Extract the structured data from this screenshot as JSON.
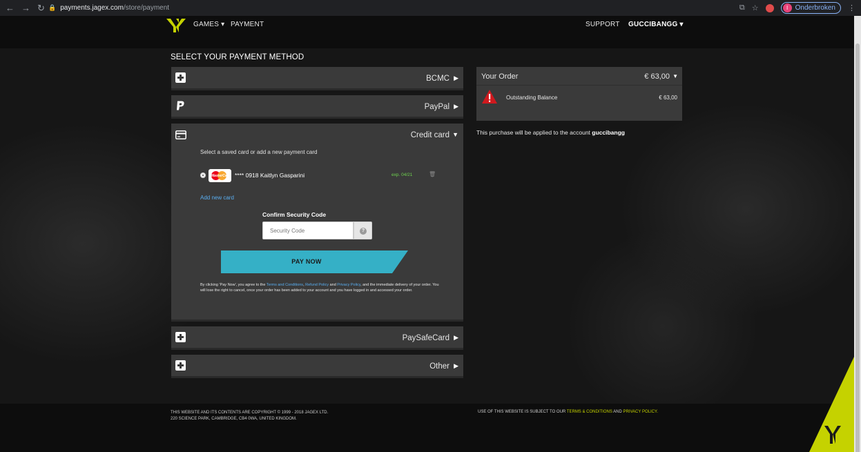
{
  "browser": {
    "url_host": "payments.jagex.com",
    "url_path": "/store/payment",
    "profile_initial": "I",
    "profile_label": "Onderbroken"
  },
  "nav": {
    "games": "GAMES ▾",
    "payment": "PAYMENT",
    "support": "SUPPORT",
    "user": "GUCCIBANGG ▾"
  },
  "page": {
    "section_title": "SELECT YOUR PAYMENT METHOD"
  },
  "methods": {
    "bcmc": "BCMC",
    "paypal": "PayPal",
    "credit_card": "Credit card",
    "paysafecard": "PaySafeCard",
    "other": "Other"
  },
  "credit_card": {
    "subtitle": "Select a saved card or add a new payment card",
    "card_brand_text": "MasterCard",
    "card_number": "**** 0918  Kaitlyn Gasparini",
    "card_expiry": "exp. 04/21",
    "add_new_card": "Add new card",
    "confirm_label": "Confirm Security Code",
    "security_placeholder": "Security Code",
    "help_glyph": "?",
    "pay_now": "PAY NOW",
    "terms_1": "By clicking 'Pay Now', you agree to the ",
    "terms_link_1": "Terms and Conditions",
    "terms_2": ", ",
    "terms_link_2": "Refund Policy",
    "terms_3": " and ",
    "terms_link_3": "Privacy Policy",
    "terms_4": ", and the immediate delivery of your order. You will lose the right to cancel, once your order has been added to your account and you have logged in and accessed your order."
  },
  "order": {
    "title": "Your Order",
    "total": "€ 63,00",
    "balance_label": "Outstanding Balance",
    "balance_value": "€ 63,00",
    "applied_text": "This purchase will be applied to the account ",
    "account": "guccibangg"
  },
  "footer": {
    "copyright_line1": "THIS WEBSITE AND ITS CONTENTS ARE COPYRIGHT © 1999 - 2018 JAGEX LTD.",
    "copyright_line2": "220 SCIENCE PARK, CAMBRIDGE, CB4 0WA, UNITED KINGDOM.",
    "use_text": "USE OF THIS WEBSITE IS SUBJECT TO OUR ",
    "terms_link": "TERMS & CONDITIONS",
    "and_text": " AND ",
    "privacy_link": "PRIVACY POLICY."
  },
  "colors": {
    "accent_yellow": "#c5d200",
    "pay_button": "#35b0c6",
    "panel": "#3a3a3a",
    "link_blue": "#5aaef0",
    "expiry_green": "#6fd34f"
  }
}
